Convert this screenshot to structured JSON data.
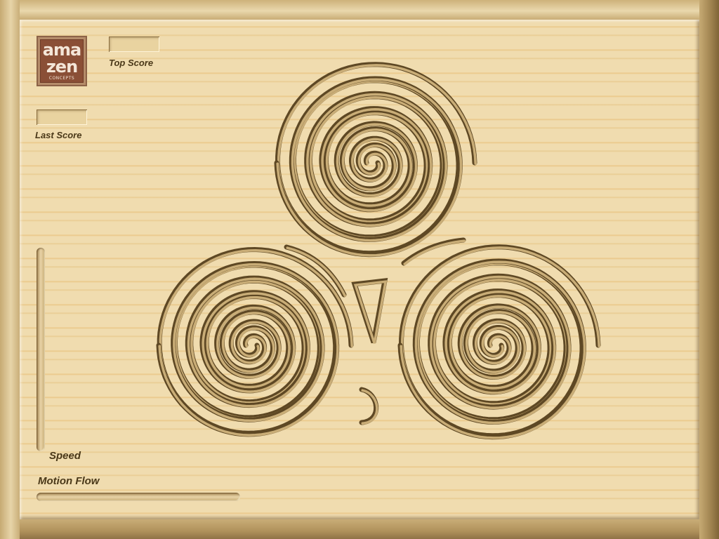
{
  "logo": {
    "line1": "ama",
    "line2": "zen",
    "line3": "CONCEPTS"
  },
  "scores": {
    "top_label": "Top Score",
    "top_value": "",
    "last_label": "Last Score",
    "last_value": ""
  },
  "controls": {
    "speed_label": "Speed",
    "motion_label": "Motion Flow"
  },
  "colors": {
    "board": "#f0dcaf",
    "groove": "#5a4420",
    "logo": "#8a4f36"
  }
}
